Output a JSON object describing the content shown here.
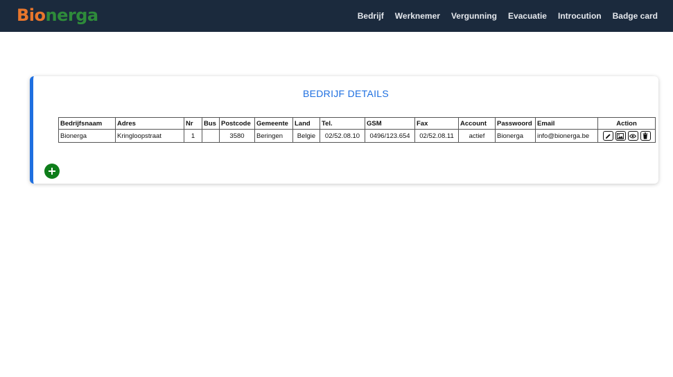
{
  "brand": {
    "part1": "B",
    "part2": "io",
    "part3": "nerga"
  },
  "nav": [
    "Bedrijf",
    "Werknemer",
    "Vergunning",
    "Evacuatie",
    "Introcution",
    "Badge card"
  ],
  "card": {
    "title": "BEDRIJF DETAILS"
  },
  "table": {
    "headers": [
      "Bedrijfsnaam",
      "Adres",
      "Nr",
      "Bus",
      "Postcode",
      "Gemeente",
      "Land",
      "Tel.",
      "GSM",
      "Fax",
      "Account",
      "Passwoord",
      "Email",
      "Action"
    ],
    "rows": [
      [
        "Bionerga",
        "Kringloopstraat",
        "1",
        "",
        "3580",
        "Beringen",
        "Belgie",
        "02/52.08.10",
        "0496/123.654",
        "02/52.08.11",
        "actief",
        "Bionerga",
        "info@bionerga.be"
      ]
    ]
  },
  "icons": {
    "edit": "pencil-icon",
    "image": "image-icon",
    "view": "eye-icon",
    "delete": "trash-icon",
    "add": "plus-icon"
  }
}
